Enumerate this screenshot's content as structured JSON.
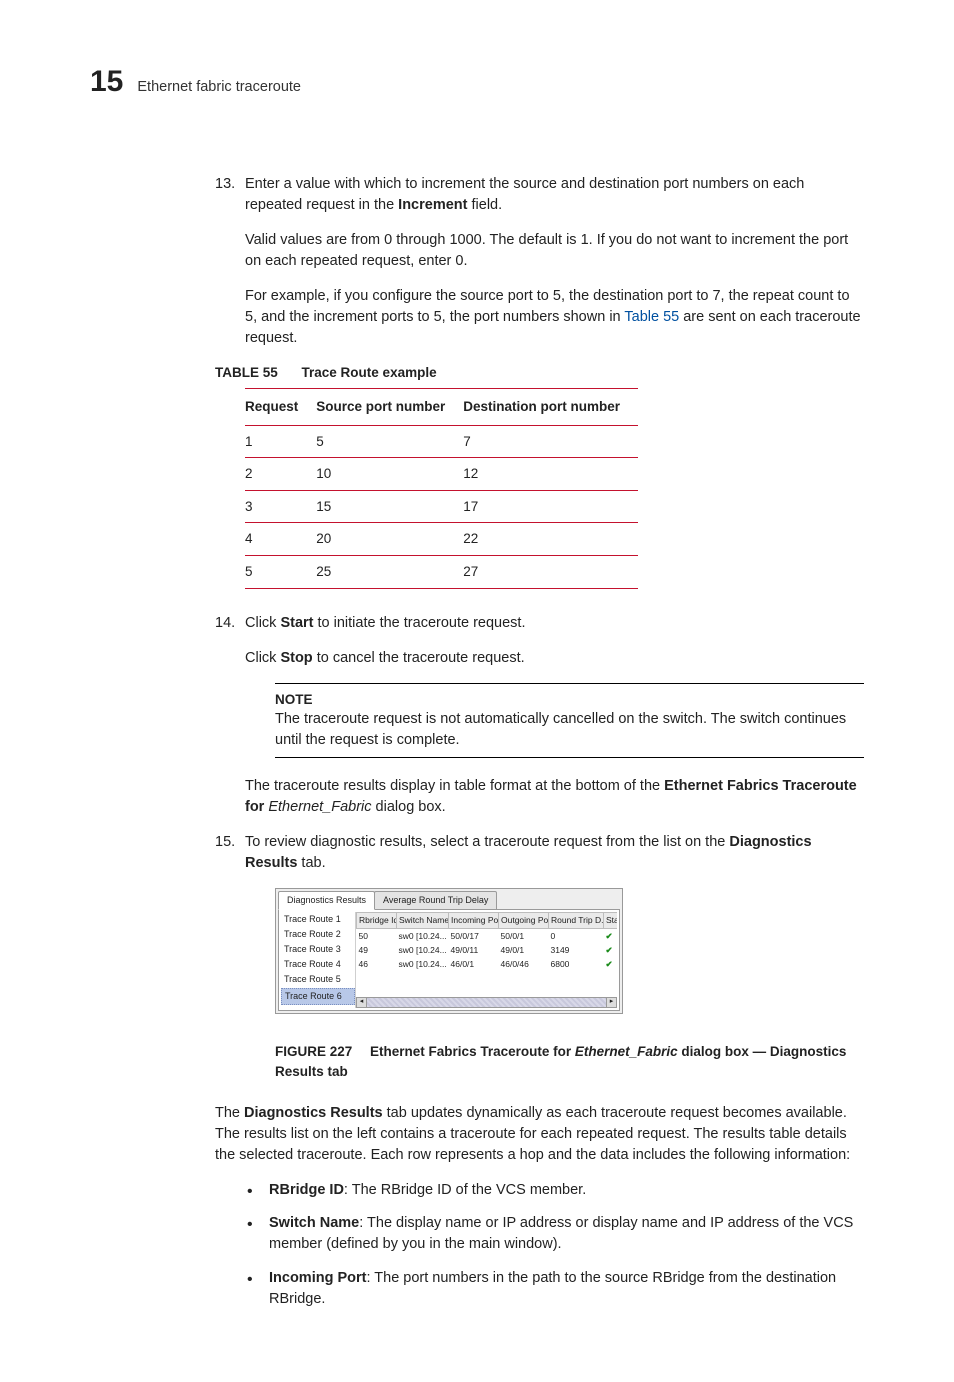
{
  "header": {
    "chapter": "15",
    "title": "Ethernet fabric traceroute"
  },
  "steps": {
    "s13": {
      "num": "13.",
      "p1a": "Enter a value with which to increment the source and destination port numbers on each repeated request in the ",
      "p1b": "Increment",
      "p1c": " field.",
      "p2": "Valid values are from 0 through 1000. The default is 1. If you do not want to increment the port on each repeated request, enter 0.",
      "p3a": "For example, if you configure the source port to 5, the destination port to 7, the repeat count to 5, and the increment ports to 5, the port numbers shown in ",
      "p3link": "Table 55",
      "p3b": " are sent on each traceroute request."
    },
    "s14": {
      "num": "14.",
      "p1a": "Click ",
      "p1b": "Start",
      "p1c": " to initiate the traceroute request.",
      "p2a": "Click ",
      "p2b": "Stop",
      "p2c": " to cancel the traceroute request."
    },
    "s15": {
      "num": "15.",
      "p1a": "To review diagnostic results, select a traceroute request from the list on the ",
      "p1b": "Diagnostics Results",
      "p1c": " tab."
    }
  },
  "table55": {
    "label": "TABLE 55",
    "title": "Trace Route example",
    "headers": [
      "Request",
      "Source port number",
      "Destination port number"
    ],
    "rows": [
      [
        "1",
        "5",
        "7"
      ],
      [
        "2",
        "10",
        "12"
      ],
      [
        "3",
        "15",
        "17"
      ],
      [
        "4",
        "20",
        "22"
      ],
      [
        "5",
        "25",
        "27"
      ]
    ]
  },
  "note": {
    "label": "NOTE",
    "text": "The traceroute request is not automatically cancelled on the switch. The switch continues until the request is complete."
  },
  "afterNote": {
    "p1a": "The traceroute results display in table format at the bottom of the ",
    "p1b": "Ethernet Fabrics Traceroute for ",
    "p1c": "Ethernet_Fabric",
    "p1d": " dialog box."
  },
  "figure": {
    "tabs": {
      "active": "Diagnostics Results",
      "other": "Average Round Trip Delay"
    },
    "leftItems": [
      "Trace Route 1",
      "Trace Route 2",
      "Trace Route 3",
      "Trace Route 4",
      "Trace Route 5",
      "Trace Route 6"
    ],
    "selectedIndex": 5,
    "cols": [
      "Rbridge Id",
      "Switch Name",
      "Incoming Port",
      "Outgoing Port",
      "Round Trip D...",
      "Status"
    ],
    "rows": [
      [
        "50",
        "sw0 [10.24...",
        "50/0/17",
        "50/0/1",
        "0",
        "✔"
      ],
      [
        "49",
        "sw0 [10.24...",
        "49/0/11",
        "49/0/1",
        "3149",
        "✔"
      ],
      [
        "46",
        "sw0 [10.24...",
        "46/0/1",
        "46/0/46",
        "6800",
        "✔"
      ]
    ]
  },
  "figureCaption": {
    "label": "FIGURE 227",
    "t1": "Ethernet Fabrics Traceroute for ",
    "t2": "Ethernet_Fabric",
    "t3": " dialog box — Diagnostics Results tab"
  },
  "afterFigure": {
    "p1a": "The ",
    "p1b": "Diagnostics Results",
    "p1c": " tab updates dynamically as each traceroute request becomes available. The results list on the left contains a traceroute for each repeated request. The results table details the selected traceroute. Each row represents a hop and the data includes the following information:"
  },
  "bullets": {
    "b1": {
      "label": "RBridge ID",
      "text": ": The RBridge ID of the VCS member."
    },
    "b2": {
      "label": "Switch Name",
      "text": ": The display name or IP address or display name and IP address of the VCS member (defined by you in the main window)."
    },
    "b3": {
      "label": "Incoming Port",
      "text": ": The port numbers in the path to the source RBridge from the destination RBridge."
    }
  }
}
